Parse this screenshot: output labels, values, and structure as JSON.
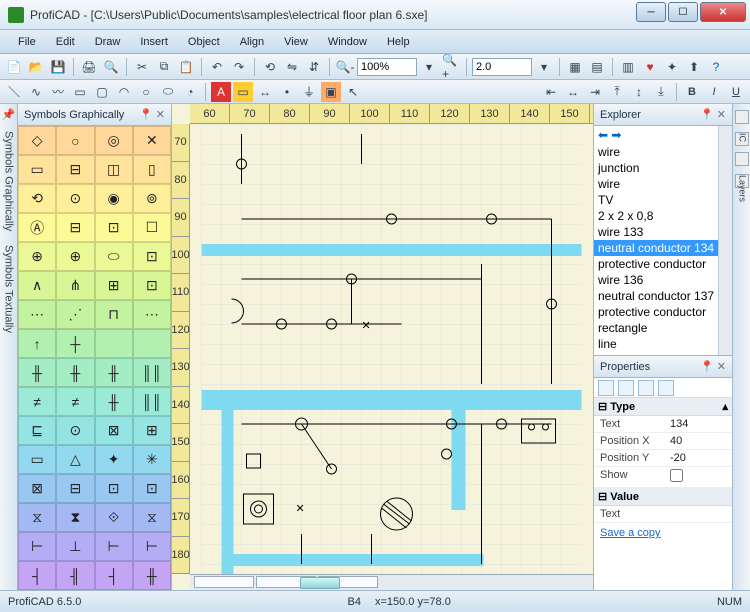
{
  "title": "ProfiCAD - [C:\\Users\\Public\\Documents\\samples\\electrical floor plan 6.sxe]",
  "menu": [
    "File",
    "Edit",
    "Draw",
    "Insert",
    "Object",
    "Align",
    "View",
    "Window",
    "Help"
  ],
  "zoom": {
    "value": "100%",
    "step": "2.0"
  },
  "palette": {
    "title": "Symbols Graphically"
  },
  "ruler_h": [
    "60",
    "70",
    "80",
    "90",
    "100",
    "110",
    "120",
    "130",
    "140",
    "150"
  ],
  "ruler_v": [
    "70",
    "80",
    "90",
    "100",
    "110",
    "120",
    "130",
    "140",
    "150",
    "160",
    "170",
    "180"
  ],
  "explorer": {
    "title": "Explorer",
    "items": [
      "wire",
      "junction",
      "wire",
      "TV",
      "2 x 2 x 0,8",
      "wire 133",
      "neutral conductor 134",
      "protective conductor",
      "wire 136",
      "neutral conductor 137",
      "protective conductor",
      "rectangle",
      "line"
    ],
    "selected": 6
  },
  "properties": {
    "title": "Properties",
    "type_hdr": "Type",
    "value_hdr": "Value",
    "rows": [
      {
        "k": "Text",
        "v": "134"
      },
      {
        "k": "Position X",
        "v": "40"
      },
      {
        "k": "Position Y",
        "v": "-20"
      },
      {
        "k": "Show",
        "v": "",
        "cb": true
      }
    ],
    "vrows": [
      {
        "k": "Text",
        "v": ""
      }
    ],
    "save": "Save a copy"
  },
  "status": {
    "left": "ProfiCAD 6.5.0",
    "cell": "B4",
    "coords": "x=150.0  y=78.0",
    "num": "NUM"
  },
  "lefttabs": [
    "Symbols Graphically",
    "Symbols Textually"
  ],
  "righttabs": [
    "IC",
    "Layers"
  ]
}
